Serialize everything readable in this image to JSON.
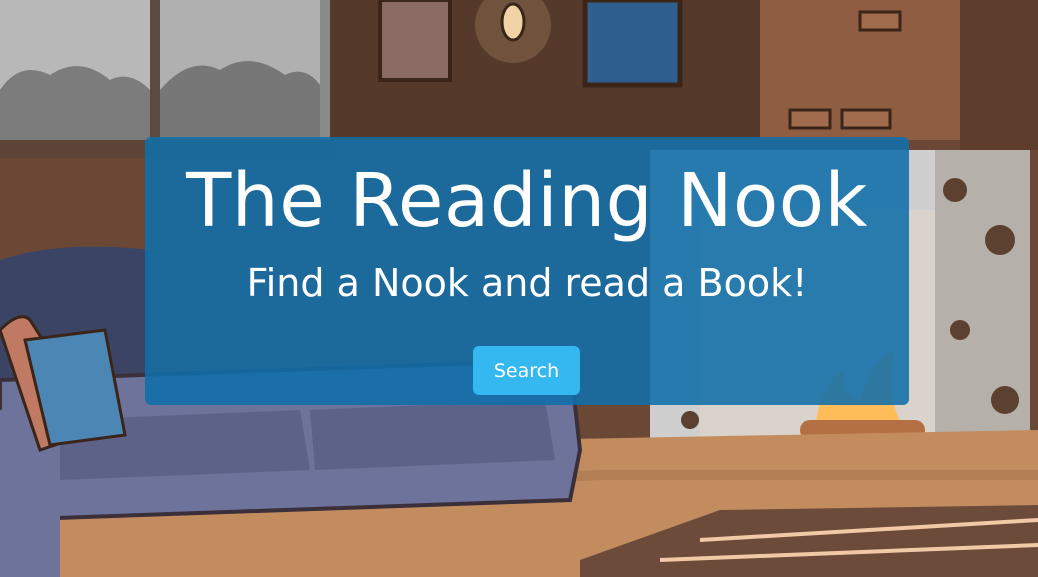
{
  "hero": {
    "title": "The Reading Nook",
    "subtitle": "Find a Nook and read a Book!",
    "search_label": "Search"
  },
  "colors": {
    "hero_bg": "#106eaa",
    "button_bg": "#34b8ef",
    "text": "#ffffff"
  }
}
